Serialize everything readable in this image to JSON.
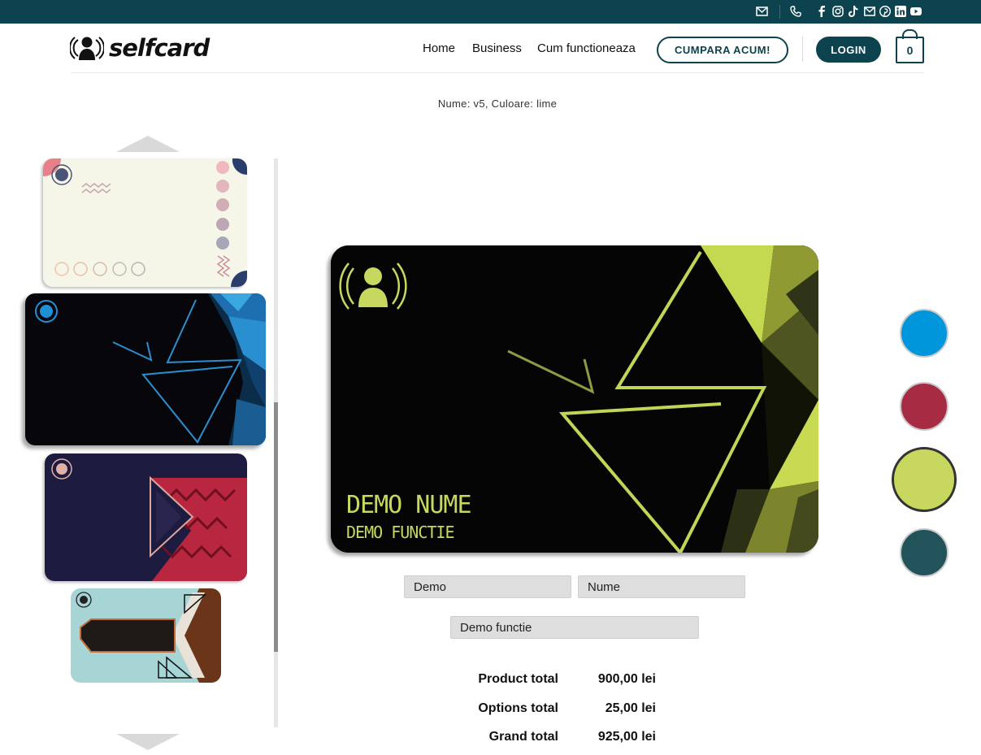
{
  "topbar": {
    "icons": [
      "envelope-icon",
      "phone-icon",
      "facebook-icon",
      "instagram-icon",
      "tiktok-icon",
      "email-icon",
      "pinterest-icon",
      "linkedin-icon",
      "youtube-icon"
    ]
  },
  "header": {
    "logo_text": "selfcard",
    "nav": [
      "Home",
      "Business",
      "Cum functioneaza"
    ],
    "buy_button": "CUMPARA ACUM!",
    "login_button": "LOGIN",
    "cart_count": "0"
  },
  "product": {
    "subtitle": "Nume: v5, Culoare: lime",
    "card_name": "DEMO NUME",
    "card_function": "DEMO FUNCTIE"
  },
  "form": {
    "first_name": "Demo",
    "last_name": "Nume",
    "function": "Demo functie"
  },
  "totals": [
    {
      "label": "Product total",
      "value": "900,00 lei"
    },
    {
      "label": "Options total",
      "value": "25,00 lei"
    },
    {
      "label": "Grand total",
      "value": "925,00 lei"
    }
  ],
  "colors": {
    "brand": "#0d434e",
    "swatches": [
      {
        "name": "blue",
        "hex": "#0096db",
        "selected": false
      },
      {
        "name": "red",
        "hex": "#a72b43",
        "selected": false
      },
      {
        "name": "lime",
        "hex": "#c8d85e",
        "selected": true
      },
      {
        "name": "teal",
        "hex": "#22525a",
        "selected": false
      }
    ]
  }
}
